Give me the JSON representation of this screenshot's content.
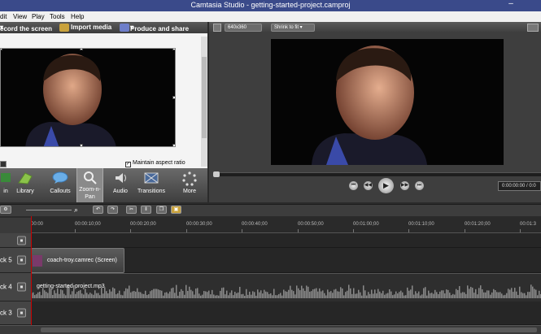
{
  "window": {
    "title": "Camtasia Studio - getting-started-project.camproj"
  },
  "menu": [
    "dit",
    "View",
    "Play",
    "Tools",
    "Help"
  ],
  "toolbar": {
    "record_label": "ecord the screen",
    "import_label": "Import media",
    "produce_label": "Produce and share"
  },
  "canvas": {
    "maintain_aspect_label": "Maintain aspect ratio",
    "maintain_aspect_checked": true
  },
  "tasks": [
    {
      "label": "in",
      "icon": "clip-bin-icon"
    },
    {
      "label": "Library",
      "icon": "library-icon"
    },
    {
      "label": "Callouts",
      "icon": "callout-icon"
    },
    {
      "label": "Zoom-n-\nPan",
      "icon": "zoom-icon",
      "active": true
    },
    {
      "label": "Audio",
      "icon": "audio-icon"
    },
    {
      "label": "Transitions",
      "icon": "transitions-icon"
    },
    {
      "label": "More",
      "icon": "more-icon"
    }
  ],
  "preview": {
    "size_label": "640x360",
    "zoom_label": "Shrink to fit",
    "timecode": "0:00:00:00 / 0:0"
  },
  "timeline": {
    "ticks": [
      "00:00",
      "00:00:10;00",
      "00:00:20;00",
      "00:00:30;00",
      "00:00:40;00",
      "00:00:50;00",
      "00:01:00;00",
      "00:01:10;00",
      "00:01:20;00",
      "00:01:3"
    ],
    "tracks": [
      {
        "label": "ck 5",
        "clip": "coach-troy.camrec (Screen)"
      },
      {
        "label": "ck 4",
        "clip": "getting-started-project.mp3"
      },
      {
        "label": "ck 3",
        "clip": ""
      }
    ]
  },
  "colors": {
    "title_bar": "#3a4a8a",
    "panel": "#3e3e3e",
    "timeline_bg": "#262626",
    "playhead": "#cc0000"
  }
}
